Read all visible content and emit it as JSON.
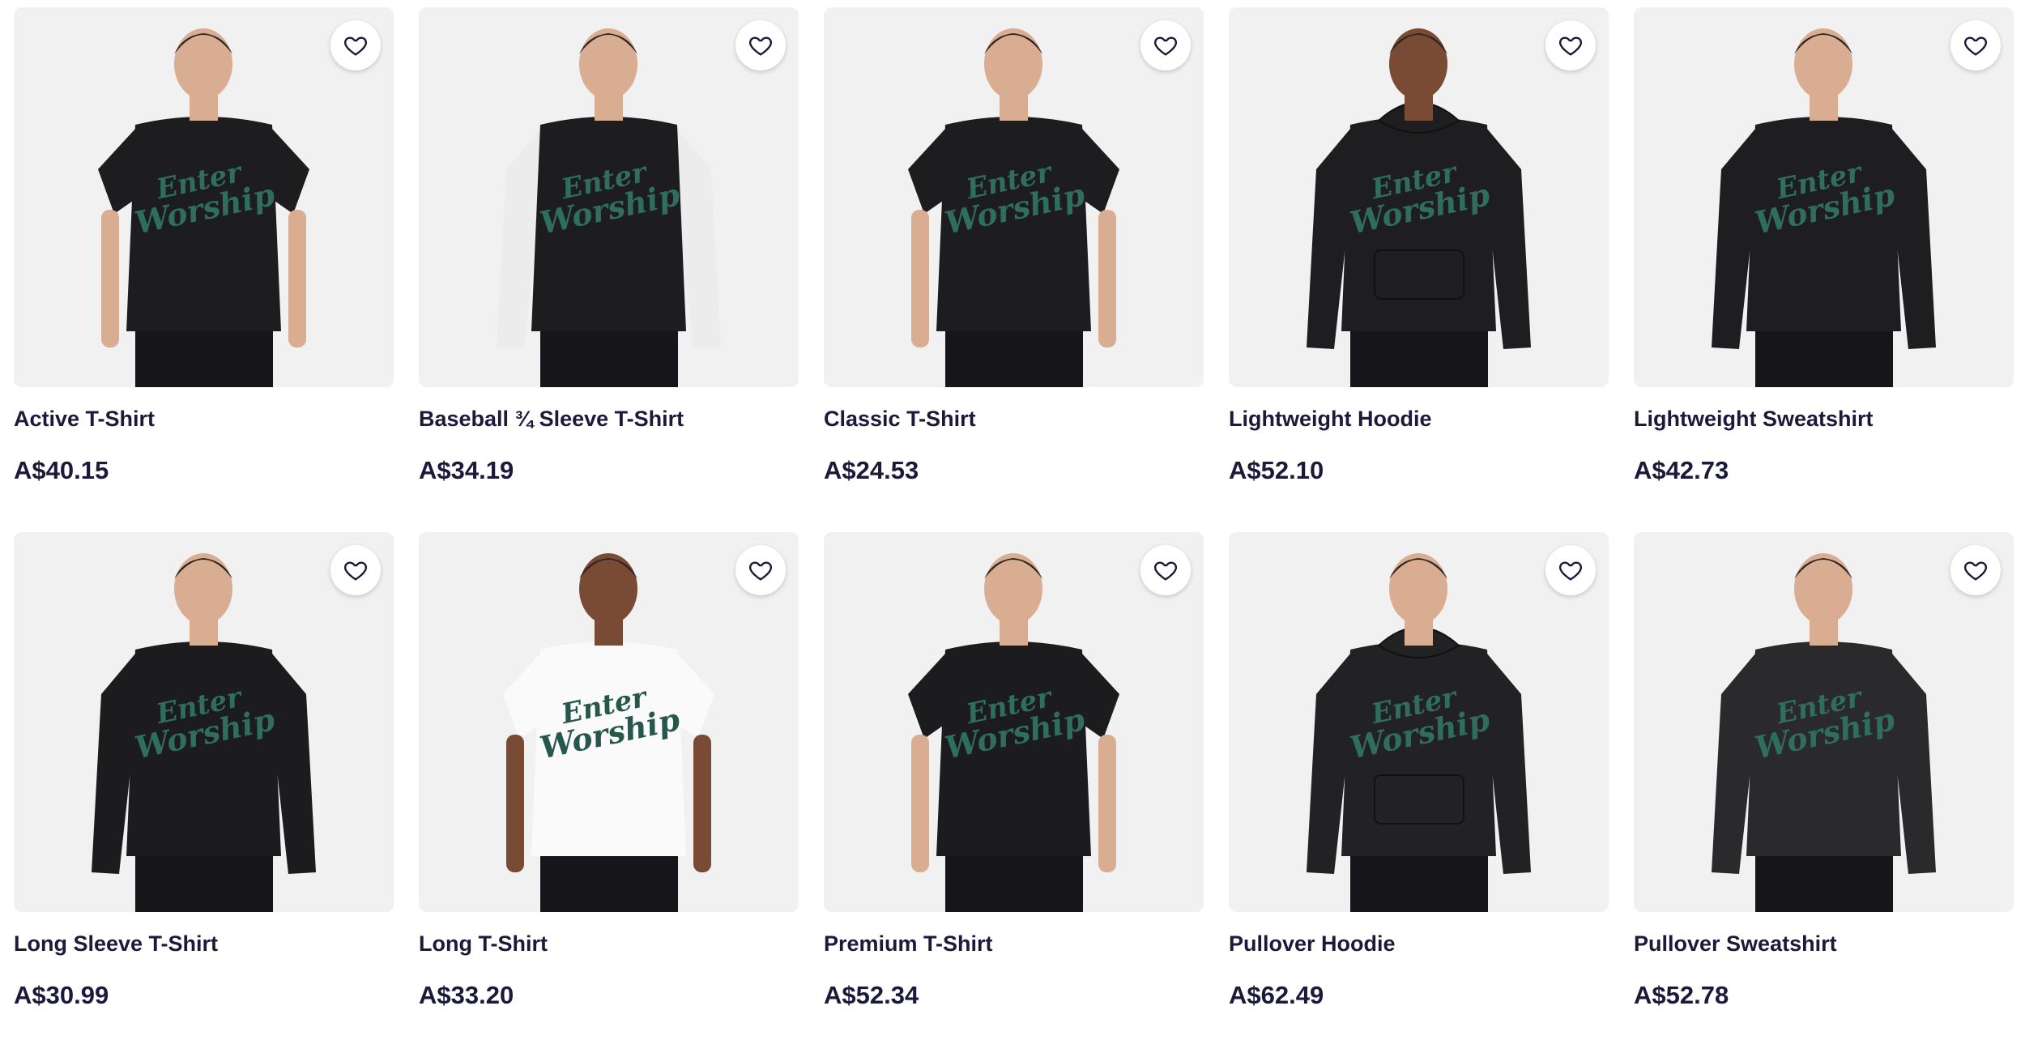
{
  "colors": {
    "text": "#1b1a3a",
    "design_green": "#2f6e5e",
    "card_bg": "#f1f1f2"
  },
  "icons": {
    "favorite": "heart-outline-icon"
  },
  "products": [
    {
      "title": "Active T-Shirt",
      "price": "A$40.15",
      "garment": "tee",
      "shirt_color": "#1d1d1f",
      "sleeve_color": "#1d1d1f",
      "long": false
    },
    {
      "title": "Baseball ¾ Sleeve T-Shirt",
      "price": "A$34.19",
      "garment": "raglan",
      "shirt_color": "#1d1d1f",
      "sleeve_color": "#ececec",
      "long": true
    },
    {
      "title": "Classic T-Shirt",
      "price": "A$24.53",
      "garment": "tee",
      "shirt_color": "#1d1d1f",
      "sleeve_color": "#1d1d1f",
      "long": false
    },
    {
      "title": "Lightweight Hoodie",
      "price": "A$52.10",
      "garment": "hoodie",
      "shirt_color": "#1e1e20",
      "sleeve_color": "#1e1e20",
      "long": true
    },
    {
      "title": "Lightweight Sweatshirt",
      "price": "A$42.73",
      "garment": "sweat",
      "shirt_color": "#1e1e20",
      "sleeve_color": "#1e1e20",
      "long": true
    },
    {
      "title": "Long Sleeve T-Shirt",
      "price": "A$30.99",
      "garment": "longtee",
      "shirt_color": "#1c1c1e",
      "sleeve_color": "#1c1c1e",
      "long": true
    },
    {
      "title": "Long T-Shirt",
      "price": "A$33.20",
      "garment": "tee",
      "shirt_color": "#fafafa",
      "sleeve_color": "#fafafa",
      "long": false
    },
    {
      "title": "Premium T-Shirt",
      "price": "A$52.34",
      "garment": "tee",
      "shirt_color": "#1c1c1e",
      "sleeve_color": "#1c1c1e",
      "long": false
    },
    {
      "title": "Pullover Hoodie",
      "price": "A$62.49",
      "garment": "hoodie",
      "shirt_color": "#222224",
      "sleeve_color": "#222224",
      "long": true
    },
    {
      "title": "Pullover Sweatshirt",
      "price": "A$52.78",
      "garment": "sweat",
      "shirt_color": "#2a2a2c",
      "sleeve_color": "#2a2a2c",
      "long": true
    }
  ],
  "design_text": [
    "Enter",
    "Worship"
  ]
}
